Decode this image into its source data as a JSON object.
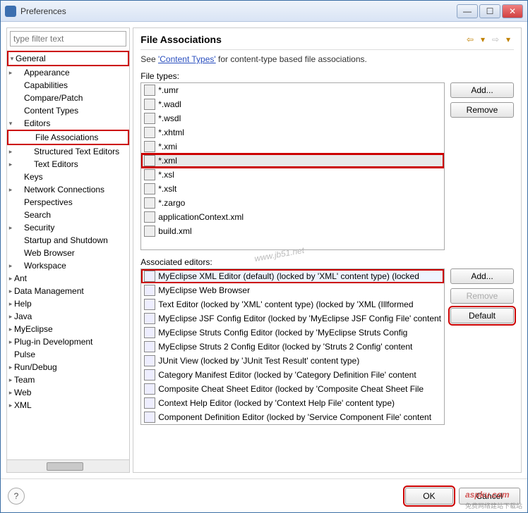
{
  "window": {
    "title": "Preferences"
  },
  "filter_placeholder": "type filter text",
  "tree": [
    {
      "label": "General",
      "indent": 0,
      "expand": "open",
      "hl": true
    },
    {
      "label": "Appearance",
      "indent": 1,
      "expand": "closed"
    },
    {
      "label": "Capabilities",
      "indent": 1
    },
    {
      "label": "Compare/Patch",
      "indent": 1
    },
    {
      "label": "Content Types",
      "indent": 1
    },
    {
      "label": "Editors",
      "indent": 1,
      "expand": "open"
    },
    {
      "label": "File Associations",
      "indent": 2,
      "hl": true
    },
    {
      "label": "Structured Text Editors",
      "indent": 2,
      "expand": "closed"
    },
    {
      "label": "Text Editors",
      "indent": 2,
      "expand": "closed"
    },
    {
      "label": "Keys",
      "indent": 1
    },
    {
      "label": "Network Connections",
      "indent": 1,
      "expand": "closed"
    },
    {
      "label": "Perspectives",
      "indent": 1
    },
    {
      "label": "Search",
      "indent": 1
    },
    {
      "label": "Security",
      "indent": 1,
      "expand": "closed"
    },
    {
      "label": "Startup and Shutdown",
      "indent": 1
    },
    {
      "label": "Web Browser",
      "indent": 1
    },
    {
      "label": "Workspace",
      "indent": 1,
      "expand": "closed"
    },
    {
      "label": "Ant",
      "indent": 0,
      "expand": "closed"
    },
    {
      "label": "Data Management",
      "indent": 0,
      "expand": "closed"
    },
    {
      "label": "Help",
      "indent": 0,
      "expand": "closed"
    },
    {
      "label": "Java",
      "indent": 0,
      "expand": "closed"
    },
    {
      "label": "MyEclipse",
      "indent": 0,
      "expand": "closed"
    },
    {
      "label": "Plug-in Development",
      "indent": 0,
      "expand": "closed"
    },
    {
      "label": "Pulse",
      "indent": 0
    },
    {
      "label": "Run/Debug",
      "indent": 0,
      "expand": "closed"
    },
    {
      "label": "Team",
      "indent": 0,
      "expand": "closed"
    },
    {
      "label": "Web",
      "indent": 0,
      "expand": "closed"
    },
    {
      "label": "XML",
      "indent": 0,
      "expand": "closed"
    }
  ],
  "heading": "File Associations",
  "intro_prefix": "See ",
  "intro_link": "'Content Types'",
  "intro_suffix": " for content-type based file associations.",
  "file_types_label": "File types:",
  "file_types": [
    {
      "label": "*.umr"
    },
    {
      "label": "*.wadl"
    },
    {
      "label": "*.wsdl"
    },
    {
      "label": "*.xhtml"
    },
    {
      "label": "*.xmi"
    },
    {
      "label": "*.xml",
      "selected": true,
      "hl": true
    },
    {
      "label": "*.xsl"
    },
    {
      "label": "*.xslt"
    },
    {
      "label": "*.zargo"
    },
    {
      "label": "applicationContext.xml"
    },
    {
      "label": "build.xml"
    }
  ],
  "ft_buttons": {
    "add": "Add...",
    "remove": "Remove"
  },
  "assoc_label": "Associated editors:",
  "assoc_editors": [
    {
      "label": "MyEclipse XML Editor (default) (locked by 'XML' content type) (locked",
      "hl": true
    },
    {
      "label": "MyEclipse Web Browser"
    },
    {
      "label": "Text Editor (locked by 'XML' content type) (locked by 'XML (Illformed"
    },
    {
      "label": "MyEclipse JSF Config Editor (locked by 'MyEclipse JSF Config File' content"
    },
    {
      "label": "MyEclipse Struts Config Editor (locked by 'MyEclipse Struts Config"
    },
    {
      "label": "MyEclipse Struts 2 Config Editor (locked by 'Struts 2 Config' content"
    },
    {
      "label": "JUnit View (locked by 'JUnit Test Result' content type)"
    },
    {
      "label": "Category Manifest Editor (locked by 'Category Definition File' content"
    },
    {
      "label": "Composite Cheat Sheet Editor (locked by 'Composite Cheat Sheet File"
    },
    {
      "label": "Context Help Editor (locked by 'Context Help File' content type)"
    },
    {
      "label": "Component Definition Editor (locked by 'Service Component File' content"
    }
  ],
  "ae_buttons": {
    "add": "Add...",
    "remove": "Remove",
    "default": "Default"
  },
  "footer": {
    "ok": "OK",
    "cancel": "Cancel"
  },
  "watermark": {
    "main": "aspku.com",
    "sub": "免费网络建站下载站"
  },
  "center_watermark": "www.jb51.net"
}
